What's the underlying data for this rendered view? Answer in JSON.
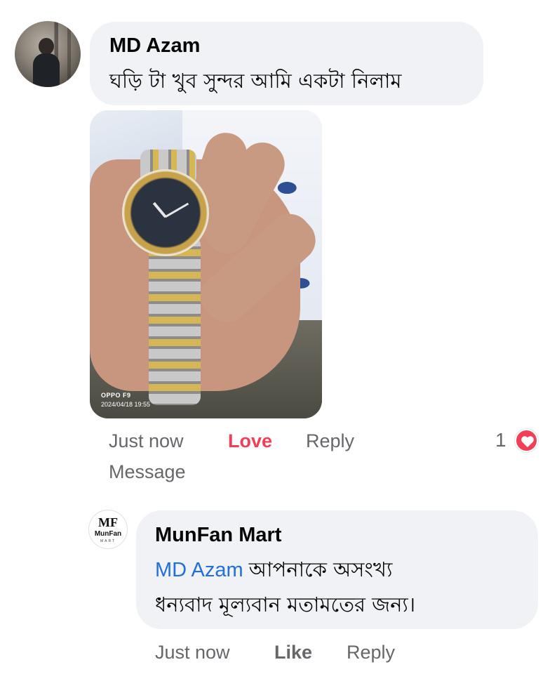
{
  "comment": {
    "author": "MD Azam",
    "text": "ঘড়ি টা খুব সুন্দর আমি একটা নিলাম",
    "photo": {
      "camera_label": "OPPO F9",
      "timestamp": "2024/04/18 19:55"
    },
    "actions": {
      "time": "Just now",
      "love": "Love",
      "reply": "Reply",
      "message": "Message"
    },
    "reactions": {
      "count": "1",
      "icon": "heart-icon",
      "color": "#f33e58"
    }
  },
  "reply": {
    "author": "MunFan Mart",
    "avatar_logo": {
      "initials": "MF",
      "name": "MunFan",
      "sub": "MART"
    },
    "mention": "MD Azam",
    "text_line1": "আপনাকে অসংখ্য",
    "text_line2": "ধন্যবাদ মূল্যবান মতামতের জন্য।",
    "actions": {
      "time": "Just now",
      "like": "Like",
      "reply": "Reply"
    }
  },
  "colors": {
    "bubble": "#f0f2f5",
    "meta_text": "#65676b",
    "love": "#f33e58",
    "mention": "#216fdb"
  }
}
